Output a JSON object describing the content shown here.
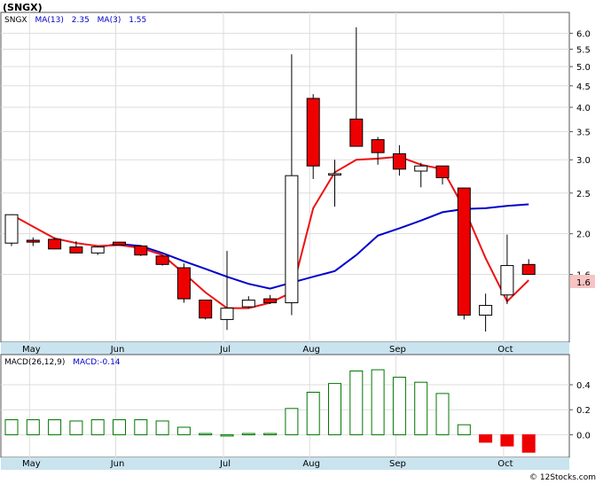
{
  "title": "(SNGX)",
  "footer": "© 12Stocks.com",
  "colors": {
    "up_candle": "#ffffff",
    "down_candle": "#ee0000",
    "ma13": "#0000cc",
    "ma3": "#ee1111",
    "macd_bar": "#007700",
    "macd_bar_negative": "#ee0000",
    "month_band": "#c9e3ef",
    "last_price_box": "#f7c3c3"
  },
  "price_legend": {
    "symbol": "SNGX",
    "ma13_label": "MA(13)",
    "ma13_value": "2.35",
    "ma3_label": "MA(3)",
    "ma3_value": "1.55"
  },
  "macd_legend": {
    "label": "MACD(26,12,9)",
    "value_label": "MACD:-0.14"
  },
  "last_price_label": "1.6",
  "chart_data": [
    {
      "type": "candlestick",
      "scale": "log",
      "ylim": [
        1.12,
        6.6
      ],
      "y_ticks": [
        "6.0",
        "5.5",
        "5.0",
        "4.5",
        "4.0",
        "3.5",
        "3.0",
        "2.5",
        "2.0",
        "1.6"
      ],
      "y_tick_values": [
        6.0,
        5.5,
        5.0,
        4.5,
        4.0,
        3.5,
        3.0,
        2.5,
        2.0,
        1.6
      ],
      "x_labels": [
        "May",
        "Jun",
        "Jul",
        "Aug",
        "Sep",
        "Oct"
      ],
      "x_label_bar_index": [
        1,
        5,
        10,
        14,
        18,
        23
      ],
      "last_price": 1.6,
      "candles": [
        {
          "o": 1.9,
          "h": 2.22,
          "l": 1.87,
          "c": 2.22
        },
        {
          "o": 1.93,
          "h": 1.96,
          "l": 1.87,
          "c": 1.91
        },
        {
          "o": 1.94,
          "h": 1.96,
          "l": 1.84,
          "c": 1.84
        },
        {
          "o": 1.86,
          "h": 1.92,
          "l": 1.8,
          "c": 1.8
        },
        {
          "o": 1.8,
          "h": 1.87,
          "l": 1.78,
          "c": 1.86
        },
        {
          "o": 1.91,
          "h": 1.91,
          "l": 1.88,
          "c": 1.88
        },
        {
          "o": 1.87,
          "h": 1.88,
          "l": 1.77,
          "c": 1.78
        },
        {
          "o": 1.77,
          "h": 1.77,
          "l": 1.68,
          "c": 1.69
        },
        {
          "o": 1.66,
          "h": 1.7,
          "l": 1.37,
          "c": 1.4
        },
        {
          "o": 1.39,
          "h": 1.39,
          "l": 1.25,
          "c": 1.26
        },
        {
          "o": 1.25,
          "h": 1.82,
          "l": 1.18,
          "c": 1.33
        },
        {
          "o": 1.34,
          "h": 1.42,
          "l": 1.33,
          "c": 1.39
        },
        {
          "o": 1.4,
          "h": 1.43,
          "l": 1.36,
          "c": 1.37
        },
        {
          "o": 1.37,
          "h": 5.35,
          "l": 1.28,
          "c": 2.75
        },
        {
          "o": 4.2,
          "h": 4.3,
          "l": 2.7,
          "c": 2.9
        },
        {
          "o": 2.78,
          "h": 3.0,
          "l": 2.32,
          "c": 2.78
        },
        {
          "o": 3.75,
          "h": 6.2,
          "l": 3.23,
          "c": 3.23
        },
        {
          "o": 3.35,
          "h": 3.4,
          "l": 2.92,
          "c": 3.12
        },
        {
          "o": 3.1,
          "h": 3.25,
          "l": 2.75,
          "c": 2.85
        },
        {
          "o": 2.82,
          "h": 2.95,
          "l": 2.58,
          "c": 2.9
        },
        {
          "o": 2.9,
          "h": 2.9,
          "l": 2.62,
          "c": 2.72
        },
        {
          "o": 2.57,
          "h": 2.57,
          "l": 1.25,
          "c": 1.28
        },
        {
          "o": 1.28,
          "h": 1.44,
          "l": 1.17,
          "c": 1.35
        },
        {
          "o": 1.43,
          "h": 1.99,
          "l": 1.36,
          "c": 1.68
        },
        {
          "o": 1.69,
          "h": 1.74,
          "l": 1.6,
          "c": 1.6
        }
      ],
      "series": [
        {
          "name": "MA(13)",
          "color": "#0000cc",
          "values": [
            null,
            null,
            null,
            null,
            1.86,
            1.89,
            1.87,
            1.8,
            1.72,
            1.65,
            1.58,
            1.52,
            1.48,
            1.53,
            1.58,
            1.63,
            1.78,
            1.98,
            2.06,
            2.15,
            2.25,
            2.29,
            2.3,
            2.33,
            2.35
          ]
        },
        {
          "name": "MA(3)",
          "color": "#ee1111",
          "values": [
            2.22,
            2.08,
            1.95,
            1.9,
            1.87,
            1.88,
            1.85,
            1.78,
            1.61,
            1.45,
            1.33,
            1.33,
            1.37,
            1.45,
            2.3,
            2.8,
            3.0,
            3.02,
            3.05,
            2.92,
            2.85,
            2.3,
            1.75,
            1.38,
            1.55
          ]
        }
      ]
    },
    {
      "type": "bar",
      "series": [
        {
          "name": "MACD",
          "values": [
            0.12,
            0.12,
            0.12,
            0.11,
            0.12,
            0.12,
            0.12,
            0.11,
            0.06,
            0.01,
            0.0,
            0.01,
            0.01,
            0.21,
            0.34,
            0.41,
            0.51,
            0.52,
            0.46,
            0.42,
            0.33,
            0.08,
            -0.06,
            -0.09,
            -0.14
          ]
        }
      ],
      "ylim": [
        -0.16,
        0.62
      ],
      "y_ticks": [
        "0.4",
        "0.2",
        "0.0"
      ],
      "y_tick_values": [
        0.4,
        0.2,
        0.0
      ],
      "x_labels": [
        "May",
        "Jun",
        "Jul",
        "Aug",
        "Sep",
        "Oct"
      ],
      "x_label_bar_index": [
        1,
        5,
        10,
        14,
        18,
        23
      ]
    }
  ]
}
